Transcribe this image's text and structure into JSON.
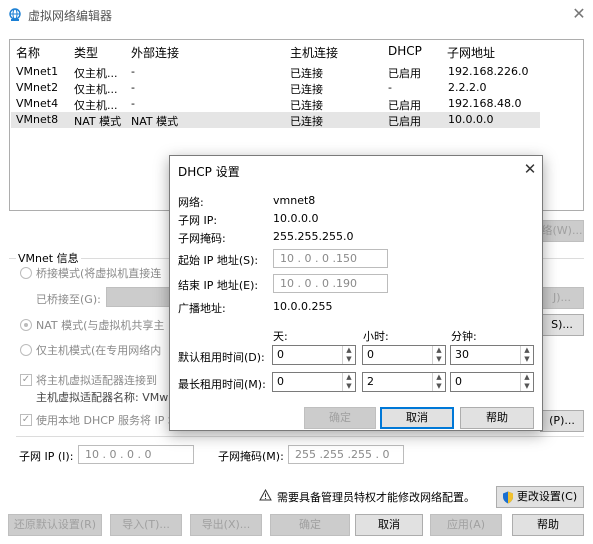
{
  "window": {
    "title": "虚拟网络编辑器",
    "close": "✕",
    "accent": "#0078d7"
  },
  "table": {
    "headers": [
      "名称",
      "类型",
      "外部连接",
      "主机连接",
      "DHCP",
      "子网地址"
    ],
    "rows": [
      [
        "VMnet1",
        "仅主机...",
        "-",
        "已连接",
        "已启用",
        "192.168.226.0"
      ],
      [
        "VMnet2",
        "仅主机...",
        "-",
        "已连接",
        "-",
        "2.2.2.0"
      ],
      [
        "VMnet4",
        "仅主机...",
        "-",
        "已连接",
        "已启用",
        "192.168.48.0"
      ],
      [
        "VMnet8",
        "NAT 模式",
        "NAT 模式",
        "已连接",
        "已启用",
        "10.0.0.0"
      ]
    ],
    "selected_index": 3
  },
  "hidden_btn_remove": "络(W)...",
  "vmnet_info": {
    "title": "VMnet 信息",
    "bridge_label": "桥接模式(将虚拟机直接连",
    "bridge_to_label": "已桥接至(G):",
    "nat_label": "NAT 模式(与虚拟机共享主",
    "host_only_label": "仅主机模式(在专用网络内",
    "adapter_check_label": "将主机虚拟适配器连接到",
    "adapter_name_label": "主机虚拟适配器名称: VMw",
    "dhcp_check_label": "使用本地 DHCP 服务将 IP 地",
    "auto_btn_partial": "J)...",
    "nat_btn_partial": "S)...",
    "dhcp_btn_partial": "(P)...",
    "subnet_ip_label": "子网 IP (I):",
    "subnet_ip_value": "10 . 0 . 0 . 0",
    "subnet_mask_label": "子网掩码(M):",
    "subnet_mask_value": "255 .255 .255 . 0"
  },
  "admin_notice": "需要具备管理员特权才能修改网络配置。",
  "change_settings_btn": "更改设置(C)",
  "bottom_buttons": {
    "restore": "还原默认设置(R)",
    "import": "导入(T)...",
    "export": "导出(X)...",
    "ok": "确定",
    "cancel": "取消",
    "apply": "应用(A)",
    "help": "帮助"
  },
  "dhcp_dialog": {
    "title": "DHCP 设置",
    "close": "✕",
    "network_label": "网络:",
    "network_value": "vmnet8",
    "subnet_ip_label": "子网 IP:",
    "subnet_ip_value": "10.0.0.0",
    "subnet_mask_label": "子网掩码:",
    "subnet_mask_value": "255.255.255.0",
    "start_ip_label": "起始 IP 地址(S):",
    "start_ip_value": "10 . 0 . 0 .150",
    "end_ip_label": "结束 IP 地址(E):",
    "end_ip_value": "10 . 0 . 0 .190",
    "broadcast_label": "广播地址:",
    "broadcast_value": "10.0.0.255",
    "col_days": "天:",
    "col_hours": "小时:",
    "col_minutes": "分钟:",
    "default_lease_label": "默认租用时间(D):",
    "default_days": "0",
    "default_hours": "0",
    "default_minutes": "30",
    "max_lease_label": "最长租用时间(M):",
    "max_days": "0",
    "max_hours": "2",
    "max_minutes": "0",
    "ok": "确定",
    "cancel": "取消",
    "help": "帮助"
  }
}
